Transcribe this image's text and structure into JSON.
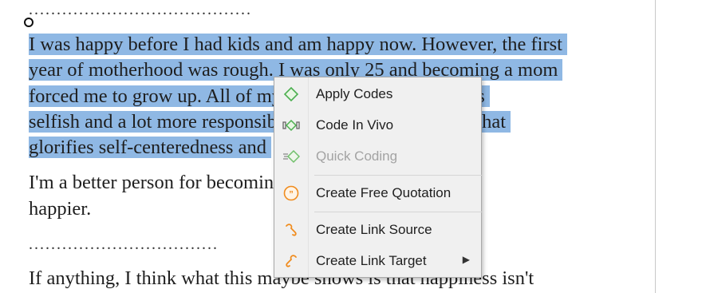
{
  "document": {
    "dots_top": "........................................",
    "para1_lines": [
      "I was happy before I had kids and am happy now. However, the first",
      "year of motherhood was rough. I was only 25 and becoming a mom",
      "forced me to grow up. All of my life I've become a lot less",
      "selfish and a lot more responsible, especially in a culture that",
      "glorifies self-centeredness and"
    ],
    "para2_lines": [
      "I'm a better person for becoming a mom, but I am not any",
      "happier."
    ],
    "dots_mid": "..................................",
    "para3_line": "If anything, I think what this maybe shows is that happiness isn't"
  },
  "context_menu": {
    "items": [
      {
        "label": "Apply Codes",
        "icon": "apply-codes-diamond-icon",
        "enabled": true
      },
      {
        "label": "Code In Vivo",
        "icon": "code-in-vivo-icon",
        "enabled": true
      },
      {
        "label": "Quick Coding",
        "icon": "quick-coding-icon",
        "enabled": false
      },
      {
        "label": "Create Free Quotation",
        "icon": "quotation-icon",
        "enabled": true
      },
      {
        "label": "Create Link Source",
        "icon": "link-source-icon",
        "enabled": true
      },
      {
        "label": "Create Link Target",
        "icon": "link-target-icon",
        "enabled": true,
        "submenu": true
      }
    ]
  },
  "colors": {
    "selection": "#8fb8e4",
    "accent_green": "#4caf50",
    "accent_orange": "#f08c1e"
  }
}
